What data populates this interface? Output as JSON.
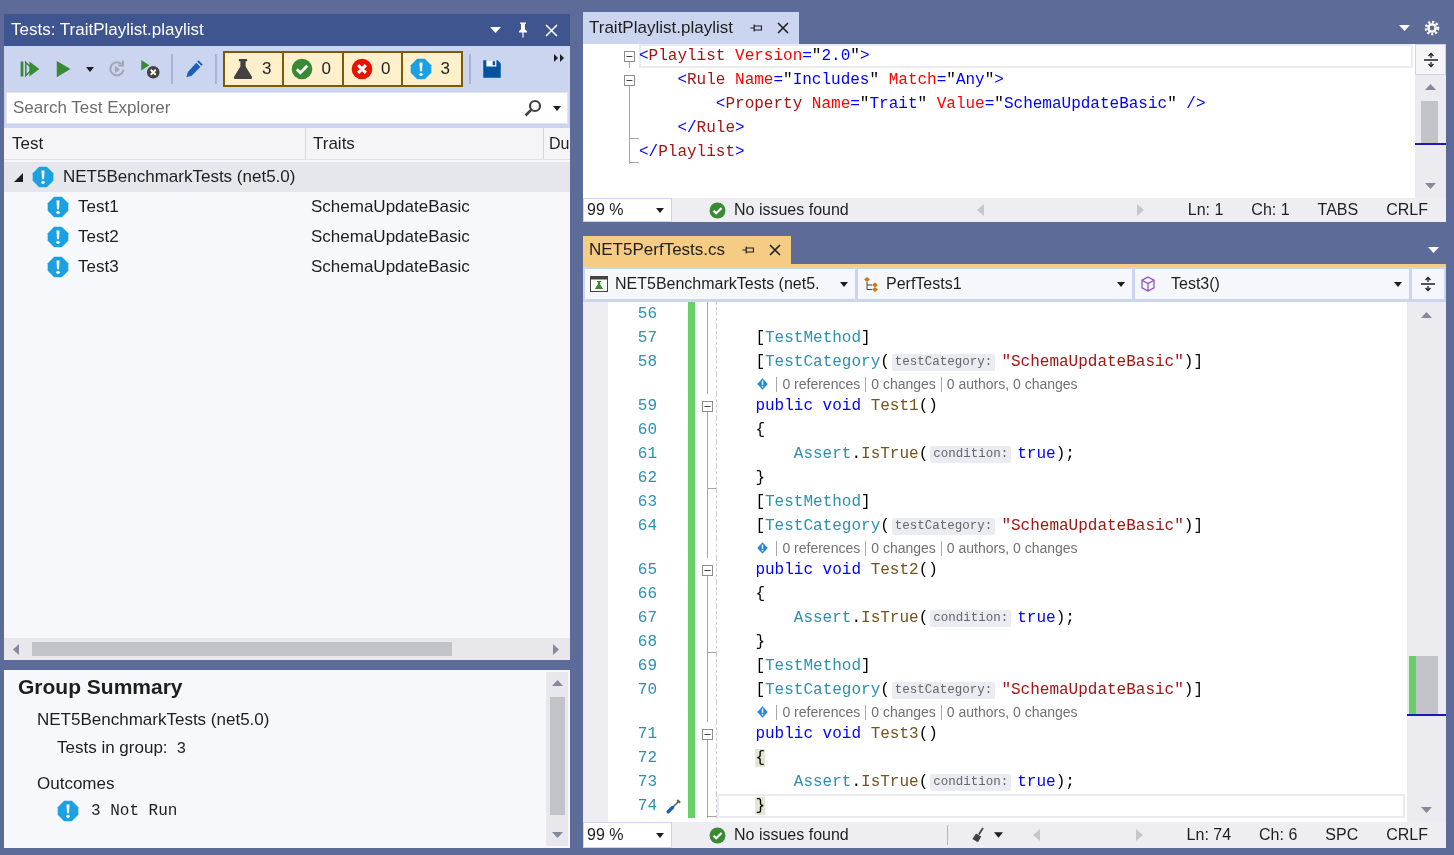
{
  "test_explorer": {
    "title": "Tests: TraitPlaylist.playlist",
    "toolbar": {
      "run_buttons": [
        {
          "kind": "run_all",
          "disabled": false
        },
        {
          "kind": "run",
          "disabled": false
        },
        {
          "kind": "menu",
          "disabled": false
        },
        {
          "kind": "repeat",
          "disabled": true
        },
        {
          "kind": "run_cancel",
          "disabled": false
        }
      ],
      "edit_buttons": [
        {
          "kind": "edit",
          "disabled": false
        }
      ],
      "counters": [
        {
          "kind": "total",
          "count": "3",
          "selected": true
        },
        {
          "kind": "passed",
          "count": "0",
          "selected": true
        },
        {
          "kind": "failed",
          "count": "0",
          "selected": true
        },
        {
          "kind": "not_run",
          "count": "3",
          "selected": true
        }
      ],
      "playlist_buttons": [
        {
          "kind": "save",
          "disabled": false
        }
      ]
    },
    "search": {
      "placeholder": "Search Test Explorer"
    },
    "columns": [
      "Test",
      "Traits",
      "Du"
    ],
    "tree": [
      {
        "label": "NET5BenchmarkTests (net5.0)",
        "kind": "not_run",
        "expanded": true,
        "selected": true,
        "children": [
          {
            "label": "Test1",
            "traits": "SchemaUpdateBasic",
            "kind": "not_run",
            "selected": false
          },
          {
            "label": "Test2",
            "traits": "SchemaUpdateBasic",
            "kind": "not_run",
            "selected": false
          },
          {
            "label": "Test3",
            "traits": "SchemaUpdateBasic",
            "kind": "not_run",
            "selected": false
          }
        ]
      }
    ]
  },
  "group_summary": {
    "title": "Group Summary",
    "group": "NET5BenchmarkTests (net5.0)",
    "count_label": "Tests in group:",
    "count": "3",
    "outcomes_label": "Outcomes",
    "outcomes": [
      {
        "kind": "not_run",
        "text": "3 Not Run"
      }
    ]
  },
  "playlist_editor": {
    "focused": false,
    "tabs": [
      {
        "label": "TraitPlaylist.playlist",
        "selected": true
      }
    ],
    "lines": [
      {
        "kind": "start",
        "current": true,
        "tokens": [
          {
            "kind": "delim",
            "text": "<"
          },
          {
            "kind": "name",
            "text": "Playlist"
          },
          {
            "kind": "attr",
            "text": " Version"
          },
          {
            "kind": "delim",
            "text": "="
          },
          {
            "kind": "quote",
            "text": "\""
          },
          {
            "kind": "value",
            "text": "2.0"
          },
          {
            "kind": "quote",
            "text": "\""
          },
          {
            "kind": "delim",
            "text": ">"
          }
        ]
      },
      {
        "kind": "start",
        "current": false,
        "tokens": [
          {
            "kind": "delim",
            "text": "    <"
          },
          {
            "kind": "name",
            "text": "Rule"
          },
          {
            "kind": "attr",
            "text": " Name"
          },
          {
            "kind": "delim",
            "text": "="
          },
          {
            "kind": "quote",
            "text": "\""
          },
          {
            "kind": "value",
            "text": "Includes"
          },
          {
            "kind": "quote",
            "text": "\""
          },
          {
            "kind": "attr",
            "text": " Match"
          },
          {
            "kind": "delim",
            "text": "="
          },
          {
            "kind": "quote",
            "text": "\""
          },
          {
            "kind": "value",
            "text": "Any"
          },
          {
            "kind": "quote",
            "text": "\""
          },
          {
            "kind": "delim",
            "text": ">"
          }
        ]
      },
      {
        "kind": "inside",
        "current": false,
        "tokens": [
          {
            "kind": "delim",
            "text": "        <"
          },
          {
            "kind": "name",
            "text": "Property"
          },
          {
            "kind": "attr",
            "text": " Name"
          },
          {
            "kind": "delim",
            "text": "="
          },
          {
            "kind": "quote",
            "text": "\""
          },
          {
            "kind": "value",
            "text": "Trait"
          },
          {
            "kind": "quote",
            "text": "\""
          },
          {
            "kind": "attr",
            "text": " Value"
          },
          {
            "kind": "delim",
            "text": "="
          },
          {
            "kind": "quote",
            "text": "\""
          },
          {
            "kind": "value",
            "text": "SchemaUpdateBasic"
          },
          {
            "kind": "quote",
            "text": "\""
          },
          {
            "kind": "delim",
            "text": " />"
          }
        ]
      },
      {
        "kind": "end",
        "current": false,
        "tokens": [
          {
            "kind": "delim",
            "text": "    </"
          },
          {
            "kind": "name",
            "text": "Rule"
          },
          {
            "kind": "delim",
            "text": ">"
          }
        ]
      },
      {
        "kind": "end",
        "current": false,
        "tokens": [
          {
            "kind": "delim",
            "text": "</"
          },
          {
            "kind": "name",
            "text": "Playlist"
          },
          {
            "kind": "delim",
            "text": ">"
          }
        ]
      }
    ],
    "status_bar": {
      "zoom": "99 %",
      "issues": "No issues found",
      "line": "Ln: 1",
      "column": "Ch: 1",
      "indentation": "TABS",
      "line_ending": "CRLF"
    }
  },
  "code_editor": {
    "focused": true,
    "tabs": [
      {
        "label": "NET5PerfTests.cs",
        "selected": true
      }
    ],
    "navigation": {
      "project": "NET5BenchmarkTests (net5.",
      "type": "PerfTests1",
      "member": "Test3()"
    },
    "lines": [
      {
        "number": "56",
        "changed": true,
        "kind": "inside",
        "current": false,
        "quick_action": false
      },
      {
        "number": "57",
        "changed": true,
        "kind": "inside",
        "current": false,
        "quick_action": false,
        "tokens": [
          {
            "kind": "punct",
            "text": "    ["
          },
          {
            "kind": "type",
            "text": "TestMethod"
          },
          {
            "kind": "punct",
            "text": "]"
          }
        ]
      },
      {
        "number": "58",
        "changed": true,
        "kind": "inside",
        "current": false,
        "quick_action": false,
        "tokens": [
          {
            "kind": "punct",
            "text": "    ["
          },
          {
            "kind": "type",
            "text": "TestCategory"
          },
          {
            "kind": "punct",
            "text": "("
          },
          {
            "kind": "hint",
            "text": "testCategory:"
          },
          {
            "kind": "string",
            "text": "\"SchemaUpdateBasic\""
          },
          {
            "kind": "punct",
            "text": ")]"
          }
        ]
      },
      {
        "number": "59",
        "changed": true,
        "kind": "start",
        "current": false,
        "quick_action": false,
        "codelens": [
          "0 references",
          "0 changes",
          "0 authors, 0 changes"
        ],
        "tokens": [
          {
            "kind": "keyword",
            "text": "    public void"
          },
          {
            "kind": "method",
            "text": " Test1"
          },
          {
            "kind": "punct",
            "text": "()"
          }
        ]
      },
      {
        "number": "60",
        "changed": true,
        "kind": "inside",
        "current": false,
        "quick_action": false,
        "tokens": [
          {
            "kind": "punct",
            "text": "    {"
          }
        ]
      },
      {
        "number": "61",
        "changed": true,
        "kind": "inside",
        "current": false,
        "quick_action": false,
        "tokens": [
          {
            "kind": "type",
            "text": "        Assert"
          },
          {
            "kind": "punct",
            "text": "."
          },
          {
            "kind": "method",
            "text": "IsTrue"
          },
          {
            "kind": "punct",
            "text": "("
          },
          {
            "kind": "hint",
            "text": "condition:"
          },
          {
            "kind": "keyword",
            "text": "true"
          },
          {
            "kind": "punct",
            "text": ");"
          }
        ]
      },
      {
        "number": "62",
        "changed": true,
        "kind": "end",
        "current": false,
        "quick_action": false,
        "tokens": [
          {
            "kind": "punct",
            "text": "    }"
          }
        ]
      },
      {
        "number": "63",
        "changed": true,
        "kind": "inside",
        "current": false,
        "quick_action": false,
        "tokens": [
          {
            "kind": "punct",
            "text": "    ["
          },
          {
            "kind": "type",
            "text": "TestMethod"
          },
          {
            "kind": "punct",
            "text": "]"
          }
        ]
      },
      {
        "number": "64",
        "changed": true,
        "kind": "inside",
        "current": false,
        "quick_action": false,
        "tokens": [
          {
            "kind": "punct",
            "text": "    ["
          },
          {
            "kind": "type",
            "text": "TestCategory"
          },
          {
            "kind": "punct",
            "text": "("
          },
          {
            "kind": "hint",
            "text": "testCategory:"
          },
          {
            "kind": "string",
            "text": "\"SchemaUpdateBasic\""
          },
          {
            "kind": "punct",
            "text": ")]"
          }
        ]
      },
      {
        "number": "65",
        "changed": true,
        "kind": "start",
        "current": false,
        "quick_action": false,
        "codelens": [
          "0 references",
          "0 changes",
          "0 authors, 0 changes"
        ],
        "tokens": [
          {
            "kind": "keyword",
            "text": "    public void"
          },
          {
            "kind": "method",
            "text": " Test2"
          },
          {
            "kind": "punct",
            "text": "()"
          }
        ]
      },
      {
        "number": "66",
        "changed": true,
        "kind": "inside",
        "current": false,
        "quick_action": false,
        "tokens": [
          {
            "kind": "punct",
            "text": "    {"
          }
        ]
      },
      {
        "number": "67",
        "changed": true,
        "kind": "inside",
        "current": false,
        "quick_action": false,
        "tokens": [
          {
            "kind": "type",
            "text": "        Assert"
          },
          {
            "kind": "punct",
            "text": "."
          },
          {
            "kind": "method",
            "text": "IsTrue"
          },
          {
            "kind": "punct",
            "text": "("
          },
          {
            "kind": "hint",
            "text": "condition:"
          },
          {
            "kind": "keyword",
            "text": "true"
          },
          {
            "kind": "punct",
            "text": ");"
          }
        ]
      },
      {
        "number": "68",
        "changed": true,
        "kind": "end",
        "current": false,
        "quick_action": false,
        "tokens": [
          {
            "kind": "punct",
            "text": "    }"
          }
        ]
      },
      {
        "number": "69",
        "changed": true,
        "kind": "inside",
        "current": false,
        "quick_action": false,
        "tokens": [
          {
            "kind": "punct",
            "text": "    ["
          },
          {
            "kind": "type",
            "text": "TestMethod"
          },
          {
            "kind": "punct",
            "text": "]"
          }
        ]
      },
      {
        "number": "70",
        "changed": true,
        "kind": "inside",
        "current": false,
        "quick_action": false,
        "tokens": [
          {
            "kind": "punct",
            "text": "    ["
          },
          {
            "kind": "type",
            "text": "TestCategory"
          },
          {
            "kind": "punct",
            "text": "("
          },
          {
            "kind": "hint",
            "text": "testCategory:"
          },
          {
            "kind": "string",
            "text": "\"SchemaUpdateBasic\""
          },
          {
            "kind": "punct",
            "text": ")]"
          }
        ]
      },
      {
        "number": "71",
        "changed": true,
        "kind": "start",
        "current": false,
        "quick_action": false,
        "codelens": [
          "0 references",
          "0 changes",
          "0 authors, 0 changes"
        ],
        "tokens": [
          {
            "kind": "keyword",
            "text": "    public void"
          },
          {
            "kind": "method",
            "text": " Test3"
          },
          {
            "kind": "punct",
            "text": "()"
          }
        ]
      },
      {
        "number": "72",
        "changed": true,
        "kind": "inside",
        "current": false,
        "quick_action": false,
        "tokens": [
          {
            "kind": "brace_match",
            "text": "    {"
          }
        ]
      },
      {
        "number": "73",
        "changed": true,
        "kind": "inside",
        "current": false,
        "quick_action": false,
        "tokens": [
          {
            "kind": "type",
            "text": "        Assert"
          },
          {
            "kind": "punct",
            "text": "."
          },
          {
            "kind": "method",
            "text": "IsTrue"
          },
          {
            "kind": "punct",
            "text": "("
          },
          {
            "kind": "hint",
            "text": "condition:"
          },
          {
            "kind": "keyword",
            "text": "true"
          },
          {
            "kind": "punct",
            "text": ");"
          }
        ]
      },
      {
        "number": "74",
        "changed": true,
        "kind": "end",
        "current": true,
        "quick_action": true,
        "tokens": [
          {
            "kind": "brace_match",
            "text": "    }"
          }
        ]
      }
    ],
    "status_bar": {
      "zoom": "99 %",
      "issues": "No issues found",
      "code_cleanup": true,
      "line": "Ln: 74",
      "column": "Ch: 6",
      "indentation": "SPC",
      "line_ending": "CRLF"
    }
  }
}
